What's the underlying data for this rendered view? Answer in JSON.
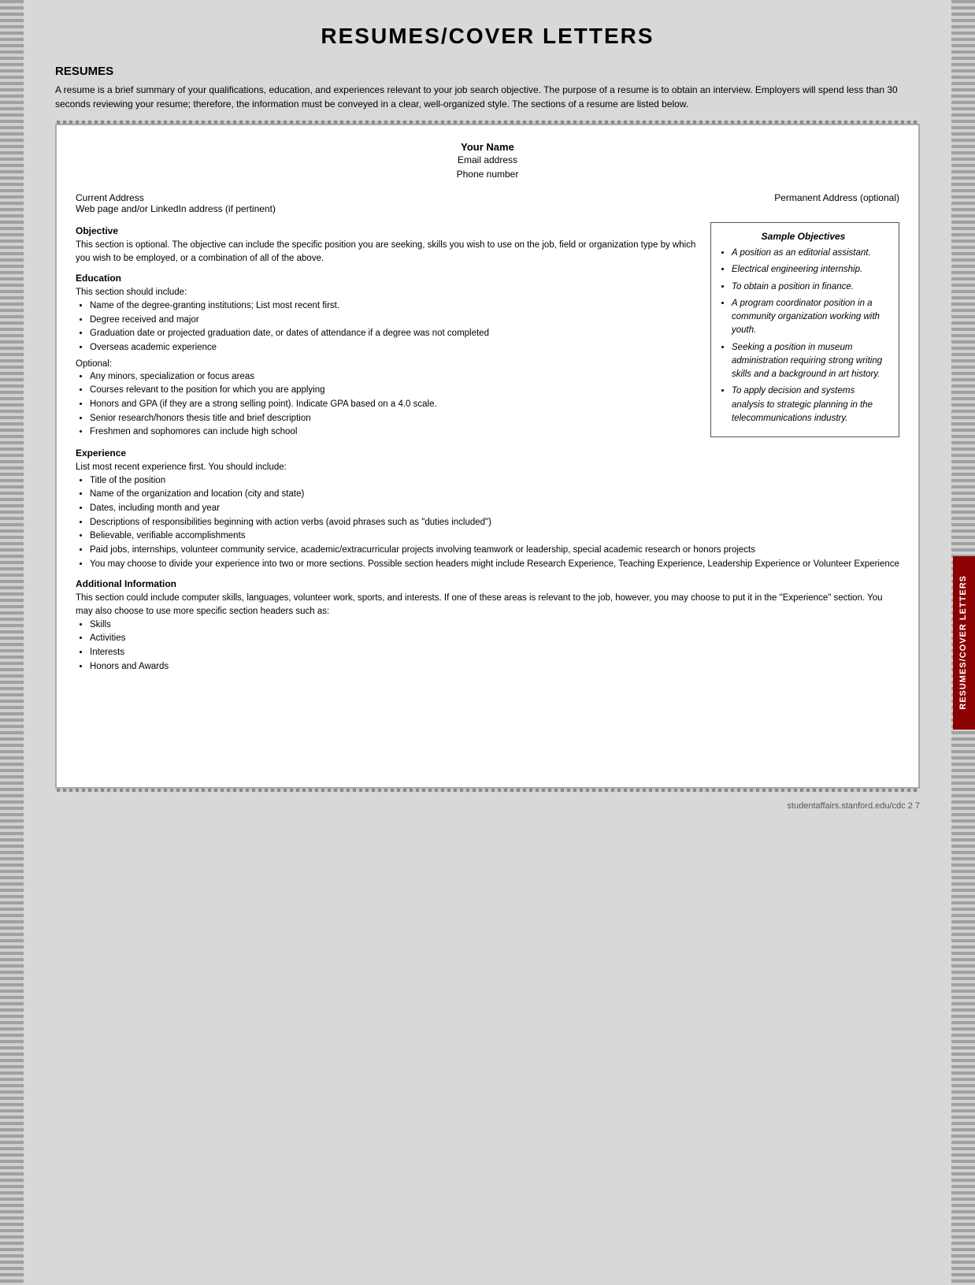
{
  "page": {
    "title": "RESUMES/COVER LETTERS",
    "footer": "studentaffairs.stanford.edu/cdc     2 7"
  },
  "right_tab": {
    "label": "RESUMES/COVER LETTERS"
  },
  "resumes_section": {
    "heading": "RESUMES",
    "intro": "A resume is a brief summary of your qualifications, education, and experiences relevant to your job search objective. The purpose of a resume is to obtain an interview. Employers will spend less than 30 seconds reviewing your resume; therefore, the information must be conveyed in a clear, well-organized style. The sections of a resume are listed below."
  },
  "resume_template": {
    "name": "Your Name",
    "email": "Email address",
    "phone": "Phone number",
    "current_address": "Current Address",
    "web_address": "Web page and/or LinkedIn address (if pertinent)",
    "permanent_address": "Permanent Address (optional)"
  },
  "resume_sections": {
    "objective": {
      "title": "Objective",
      "body": "This section is optional. The objective can include the specific position you are seeking, skills you wish to use on the job, field or organization type by which you wish to be employed, or a combination of all of the above."
    },
    "education": {
      "title": "Education",
      "intro": "This section should include:",
      "bullets": [
        "Name of the degree-granting institutions; List most recent first.",
        "Degree received and major",
        "Graduation date or projected graduation date, or dates of attendance if a degree was not completed",
        "Overseas academic experience"
      ],
      "optional_label": "Optional:",
      "optional_bullets": [
        "Any minors, specialization or focus areas",
        "Courses relevant to the position for which you are applying",
        "Honors and GPA (if they are a strong selling point). Indicate GPA based on a 4.0 scale.",
        "Senior research/honors thesis title and brief description",
        "Freshmen and sophomores can include high school"
      ]
    },
    "experience": {
      "title": "Experience",
      "intro": "List most recent experience first. You should include:",
      "bullets": [
        "Title of the position",
        "Name of the organization and location (city and state)",
        "Dates, including month and year",
        "Descriptions of responsibilities beginning with action verbs (avoid phrases such as \"duties included\")",
        "Believable, verifiable accomplishments",
        "Paid jobs, internships, volunteer community service, academic/extracurricular projects involving teamwork or leadership, special academic research or honors projects",
        "You may choose to divide your experience into two or more sections. Possible section headers might include Research Experience, Teaching Experience, Leadership Experience or Volunteer Experience"
      ]
    },
    "additional_information": {
      "title": "Additional Information",
      "body": "This section could include computer skills, languages, volunteer work, sports, and interests. If one of these areas is relevant to the job, however, you may choose to put it in the \"Experience\" section. You may also choose to use more specific section headers such as:",
      "bullets": [
        "Skills",
        "Activities",
        "Interests",
        "Honors and Awards"
      ]
    }
  },
  "sample_objectives": {
    "title": "Sample Objectives",
    "items": [
      "A position as an editorial assistant.",
      "Electrical engineering internship.",
      "To obtain a position in finance.",
      "A program coordinator position in a community organization working with youth.",
      "Seeking a position in museum administration requiring strong writing skills and a background in art history.",
      "To apply decision and systems analysis to strategic planning in the telecommunications industry."
    ]
  }
}
